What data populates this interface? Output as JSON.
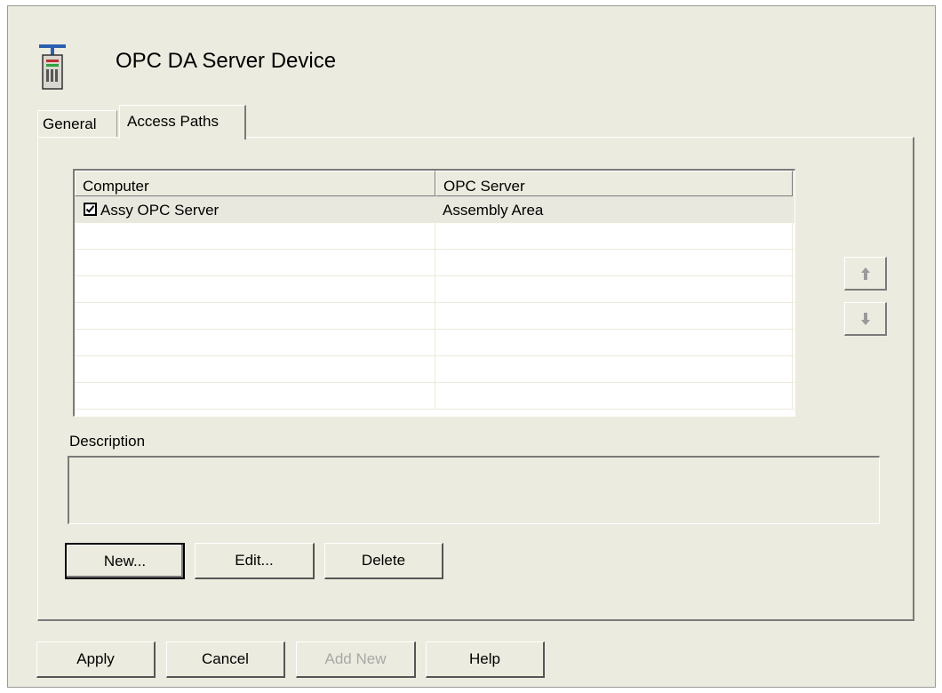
{
  "header": {
    "title": "OPC DA Server Device",
    "icon": "server-device-icon"
  },
  "tabs": [
    {
      "label": "General",
      "active": false
    },
    {
      "label": "Access Paths",
      "active": true
    }
  ],
  "access_paths": {
    "columns": [
      "Computer",
      "OPC Server"
    ],
    "rows": [
      {
        "checked": true,
        "computer": "Assy OPC Server",
        "opc_server": "Assembly Area"
      }
    ],
    "empty_rows": 7
  },
  "reorder": {
    "up_icon": "move-up-icon",
    "down_icon": "move-down-icon"
  },
  "description": {
    "label": "Description",
    "value": ""
  },
  "path_buttons": {
    "new": "New...",
    "edit": "Edit...",
    "delete": "Delete"
  },
  "footer_buttons": {
    "apply": "Apply",
    "cancel": "Cancel",
    "add_new": "Add New",
    "help": "Help"
  },
  "colors": {
    "dialog_bg": "#ecebdf",
    "shadow": "#7a7a7a",
    "highlight": "#ffffff"
  }
}
